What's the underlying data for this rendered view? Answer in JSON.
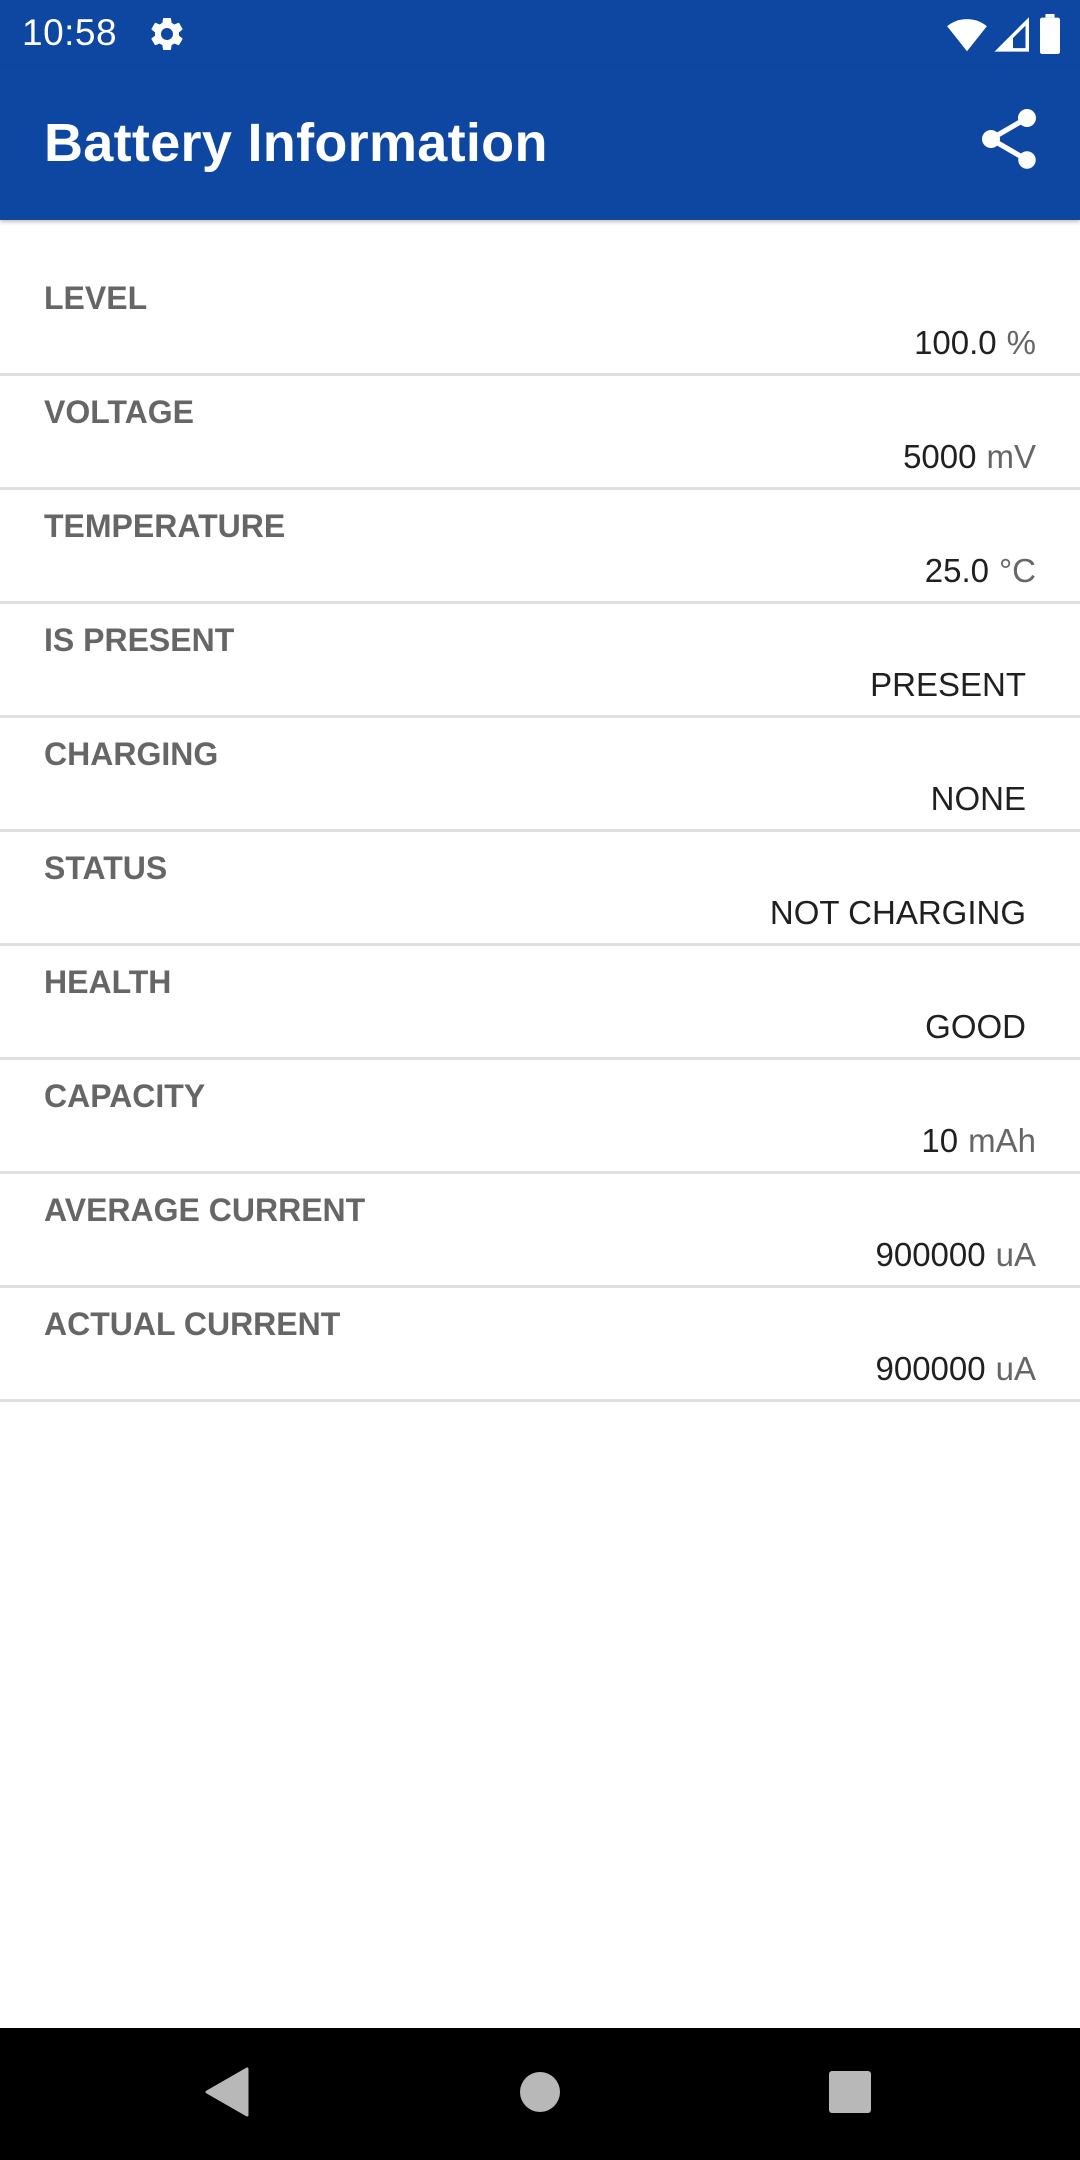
{
  "status_bar": {
    "time": "10:58",
    "icons": [
      "gear-icon",
      "wifi-icon",
      "cell-signal-icon",
      "battery-icon"
    ]
  },
  "app_bar": {
    "title": "Battery Information",
    "share_icon": "share-icon",
    "color": "#0e47a1"
  },
  "rows": [
    {
      "label": "LEVEL",
      "value": "100.0",
      "unit": "%"
    },
    {
      "label": "VOLTAGE",
      "value": "5000",
      "unit": "mV"
    },
    {
      "label": "TEMPERATURE",
      "value": "25.0",
      "unit": "°C"
    },
    {
      "label": "IS PRESENT",
      "value": "PRESENT",
      "unit": ""
    },
    {
      "label": "CHARGING",
      "value": "NONE",
      "unit": ""
    },
    {
      "label": "STATUS",
      "value": "NOT CHARGING",
      "unit": ""
    },
    {
      "label": "HEALTH",
      "value": "GOOD",
      "unit": ""
    },
    {
      "label": "CAPACITY",
      "value": "10",
      "unit": "mAh"
    },
    {
      "label": "AVERAGE CURRENT",
      "value": "900000",
      "unit": "uA"
    },
    {
      "label": "ACTUAL CURRENT",
      "value": "900000",
      "unit": "uA"
    }
  ],
  "nav_bar": {
    "icons": [
      "back-icon",
      "home-icon",
      "recents-icon"
    ]
  }
}
